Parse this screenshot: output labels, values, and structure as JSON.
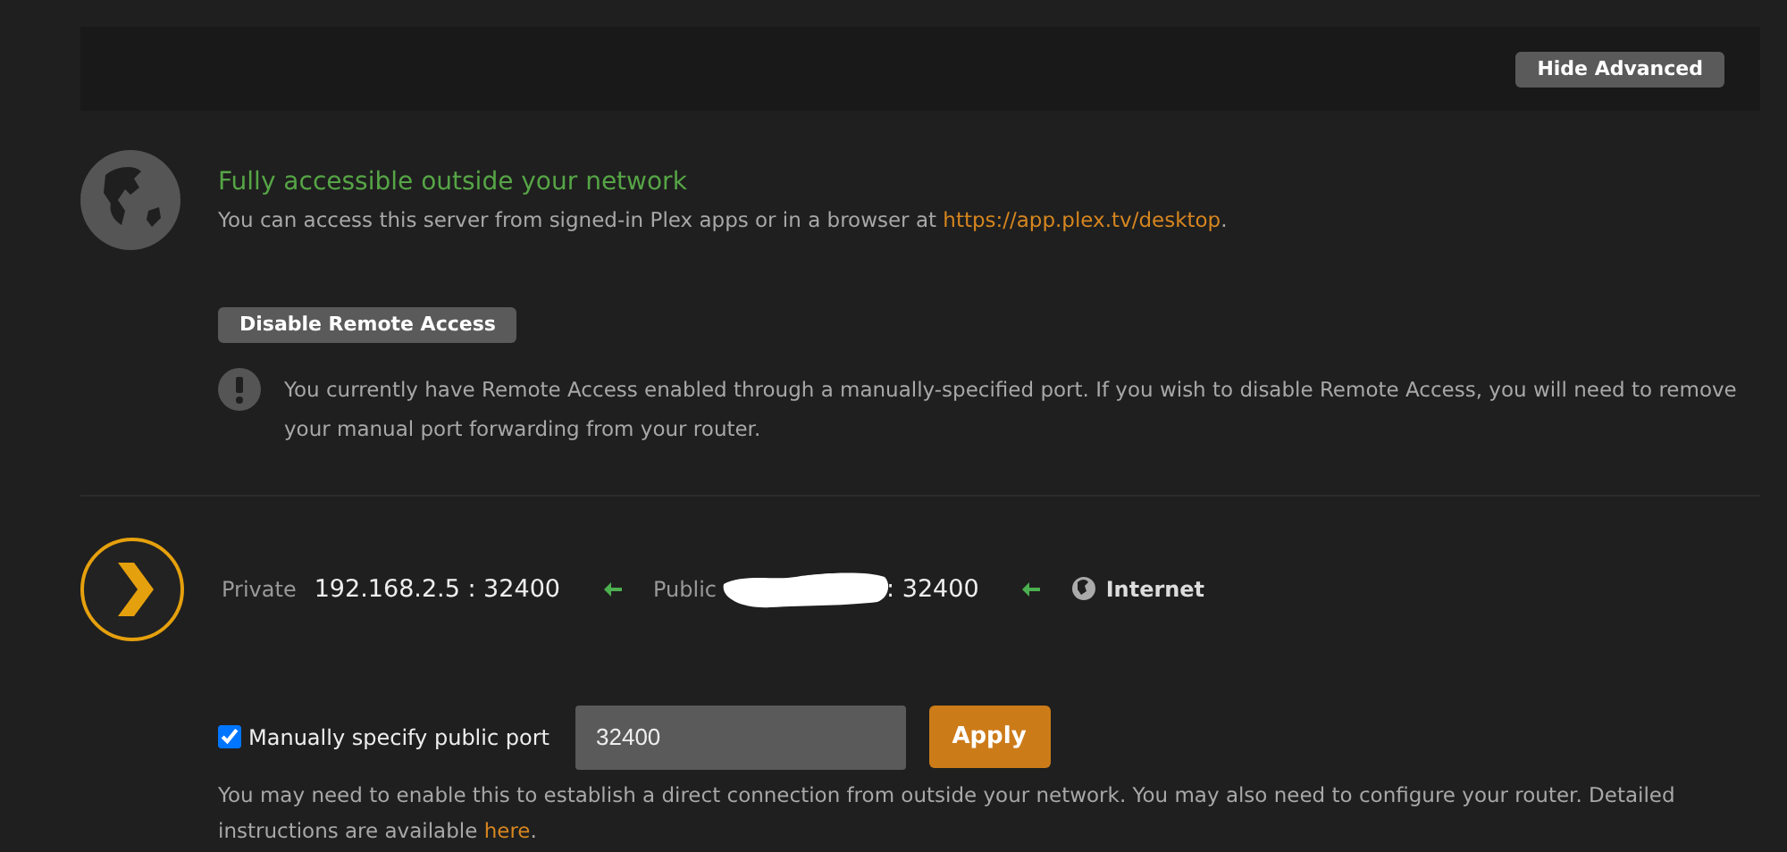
{
  "header": {
    "button": "Hide Advanced"
  },
  "status": {
    "title": "Fully accessible outside your network",
    "description": "You can access this server from signed-in Plex apps or in a browser at ",
    "link": "https://app.plex.tv/desktop",
    "suffix": "."
  },
  "disable_button": "Disable Remote Access",
  "warning": "You currently have Remote Access enabled through a manually-specified port. If you wish to disable Remote Access, you will need to remove your manual port forwarding from your router.",
  "mapping": {
    "private_label": "Private",
    "private_address": "192.168.2.5 : 32400",
    "public_label": "Public",
    "public_port": ": 32400",
    "internet_label": "Internet"
  },
  "manual_port": {
    "label": "Manually specify public port",
    "checked": true,
    "value": "32400",
    "button": "Apply"
  },
  "help": {
    "text": "You may need to enable this to establish a direct connection from outside your network. You may also need to configure your router. Detailed instructions are available ",
    "link": "here",
    "suffix": "."
  }
}
